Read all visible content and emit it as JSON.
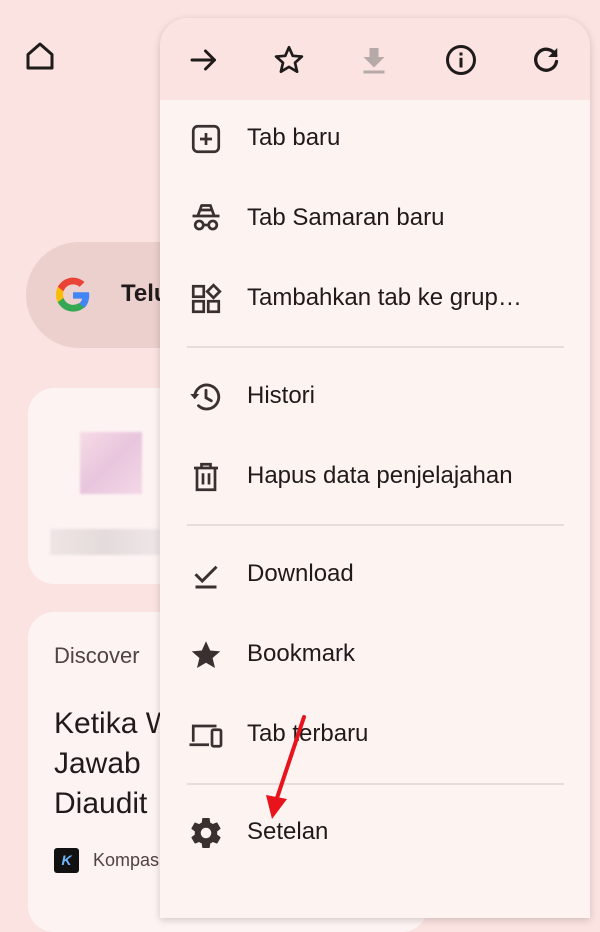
{
  "background": {
    "search_text": "Telu",
    "discover_label": "Discover",
    "headline_lines": [
      "Ketika W",
      "Jawab",
      "Diaudit"
    ],
    "source_name": "Kompas",
    "source_logo_letter": "K"
  },
  "menu": {
    "top_icons": [
      "forward-arrow-icon",
      "star-outline-icon",
      "download-icon",
      "info-icon",
      "refresh-icon"
    ],
    "items": [
      {
        "label": "Tab baru",
        "icon": "new-tab-icon"
      },
      {
        "label": "Tab Samaran baru",
        "icon": "incognito-icon"
      },
      {
        "label": "Tambahkan tab ke grup…",
        "icon": "tab-group-icon"
      },
      {
        "label": "Histori",
        "icon": "history-icon"
      },
      {
        "label": "Hapus data penjelajahan",
        "icon": "trash-icon"
      },
      {
        "label": "Download",
        "icon": "download-done-icon"
      },
      {
        "label": "Bookmark",
        "icon": "star-filled-icon"
      },
      {
        "label": "Tab terbaru",
        "icon": "devices-icon"
      },
      {
        "label": "Setelan",
        "icon": "gear-icon"
      }
    ]
  },
  "colors": {
    "background": "#fbe3e1",
    "menu_background": "#fdf4f2",
    "annotation_arrow": "#e8131b"
  }
}
